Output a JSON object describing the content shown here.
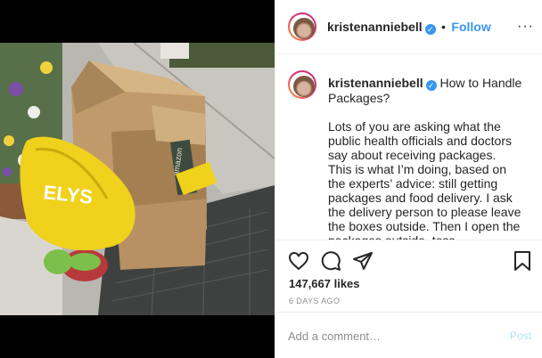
{
  "header": {
    "username": "kristenanniebell",
    "verified_mark": "✓",
    "separator": "•",
    "follow_label": "Follow",
    "more_label": "···"
  },
  "caption": {
    "username": "kristenanniebell",
    "verified_mark": "✓",
    "title": "How to Handle Packages?",
    "paragraph_1": "Lots of you are asking what the public health officials and doctors say about receiving packages.",
    "paragraph_2": "This is what I’m doing, based on the experts’ advice: still getting packages and food delivery. I ask the delivery person to please leave the boxes outside. Then I open the packages outside, toss ... everything with a wipe,"
  },
  "actions": {
    "like_icon": "heart-icon",
    "comment_icon": "comment-bubble-icon",
    "share_icon": "paper-plane-icon",
    "save_icon": "bookmark-icon",
    "likes": "147,667 likes",
    "age": "6 DAYS AGO"
  },
  "comment": {
    "placeholder": "Add a comment…",
    "post_label": "Post"
  },
  "photo": {
    "box_text": "amazon",
    "bag_text": "ELYS"
  },
  "colors": {
    "link_blue": "#3897f0",
    "post_disabled": "#b2dffc",
    "muted": "#8e8e8e",
    "border": "#efefef"
  }
}
